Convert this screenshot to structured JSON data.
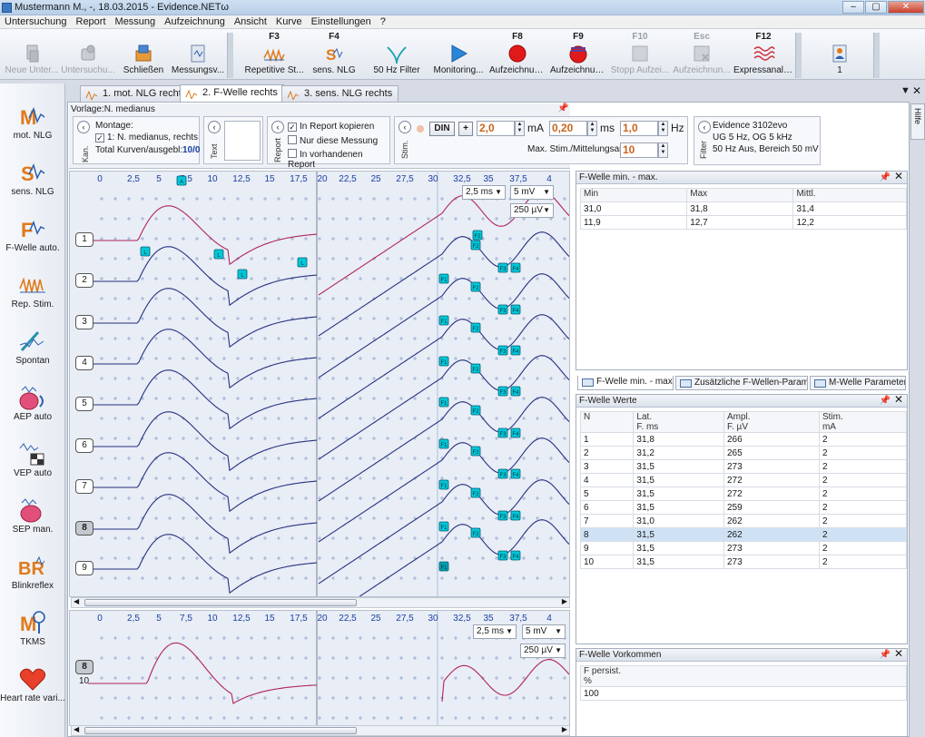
{
  "window": {
    "title": "Mustermann M., -, 18.03.2015 - Evidence.NETω",
    "controls": {
      "min": "–",
      "max": "▢",
      "close": "✕"
    }
  },
  "menu": [
    "Untersuchung",
    "Report",
    "Messung",
    "Aufzeichnung",
    "Ansicht",
    "Kurve",
    "Einstellungen",
    "?"
  ],
  "toolbar": {
    "new_exam": "Neue Unter...",
    "exam": "Untersuchu...",
    "close": "Schließen",
    "measure_settings": "Messungsv...",
    "repetitive": {
      "key": "F3",
      "label": "Repetitive St..."
    },
    "sens_nlg": {
      "key": "F4",
      "label": "sens. NLG"
    },
    "filter50": {
      "label": "50 Hz Filter"
    },
    "monitoring": {
      "label": "Monitoring..."
    },
    "record1": {
      "key": "F8",
      "label": "Aufzeichnun..."
    },
    "record2": {
      "key": "F9",
      "label": "Aufzeichnun..."
    },
    "stop": {
      "key": "F10",
      "label": "Stopp Aufzei..."
    },
    "record_esc": {
      "key": "Esc",
      "label": "Aufzeichnun..."
    },
    "express": {
      "key": "F12",
      "label": "Expressanaly..."
    },
    "user_count": "1"
  },
  "leftnav": [
    "mot. NLG",
    "sens. NLG",
    "F-Welle auto.",
    "Rep. Stim.",
    "Spontan",
    "AEP auto",
    "VEP auto",
    "SEP man.",
    "Blinkreflex",
    "TKMS",
    "Heart rate vari..."
  ],
  "leftnav_icon_letters": {
    "mot": "M",
    "sens": "S",
    "fwave": "F",
    "blink": "BR",
    "tkms": "M"
  },
  "doc_tabs": [
    "1. mot. NLG rechts",
    "2. F-Welle rechts",
    "3. sens. NLG rechts"
  ],
  "template": "Vorlage:N. medianus",
  "montage": {
    "vlabel": "Kan.",
    "title": "Montage:",
    "item": "1: N. medianus, rechts",
    "total_label": "Total Kurven/ausgebl:",
    "total_value": "10/0",
    "text_vlabel": "Text"
  },
  "report": {
    "vlabel": "Report",
    "copy": "In Report kopieren",
    "only_this": "Nur diese Messung",
    "existing": "In vorhandenen Report"
  },
  "stim": {
    "vlabel": "Stim.",
    "din": "DIN",
    "plus": "+",
    "current": "2,0",
    "current_unit": "mA",
    "duration": "0,20",
    "duration_unit": "ms",
    "freq": "1,0",
    "freq_unit": "Hz",
    "max_label": "Max. Stim./Mittelungsanzahl:",
    "max_value": "10"
  },
  "filter": {
    "vlabel": "Filter",
    "device": "Evidence 3102evo",
    "line1": "UG  5 Hz, OG  5 kHz",
    "line2": "50 Hz  Aus, Bereich  50 mV"
  },
  "scale": {
    "time": "2,5 ms",
    "volt1": "5 mV",
    "volt2": "250 µV"
  },
  "axis1": [
    "0",
    "2,5",
    "5",
    "7,5",
    "10",
    "12,5",
    "15",
    "17,5"
  ],
  "axis2": [
    "20",
    "22,5",
    "25",
    "27,5",
    "30",
    "32,5",
    "35",
    "37,5",
    "4"
  ],
  "trace_labels": [
    "1",
    "2",
    "3",
    "4",
    "5",
    "6",
    "7",
    "8",
    "9"
  ],
  "detail": {
    "label": "8",
    "sublabel": "10"
  },
  "markers": {
    "f1": "F1",
    "f2": "F2",
    "f3": "F3",
    "f4": "F4",
    "a": "A",
    "l": "L"
  },
  "minmax": {
    "title": "F-Welle min. - max.",
    "headers": [
      "Min",
      "Max",
      "Mittl."
    ],
    "rows": [
      [
        "31,0",
        "31,8",
        "31,4"
      ],
      [
        "11,9",
        "12,7",
        "12,2"
      ]
    ]
  },
  "btabs": [
    "F-Welle min. - max.",
    "Zusätzliche F-Wellen-Param...",
    "M-Welle Parameter"
  ],
  "values": {
    "title": "F-Welle Werte",
    "headers": [
      "N",
      "Lat.\nF. ms",
      "Ampl.\nF. µV",
      "Stim.\nmA"
    ],
    "rows": [
      [
        "1",
        "31,8",
        "266",
        "2"
      ],
      [
        "2",
        "31,2",
        "265",
        "2"
      ],
      [
        "3",
        "31,5",
        "273",
        "2"
      ],
      [
        "4",
        "31,5",
        "272",
        "2"
      ],
      [
        "5",
        "31,5",
        "272",
        "2"
      ],
      [
        "6",
        "31,5",
        "259",
        "2"
      ],
      [
        "7",
        "31,0",
        "262",
        "2"
      ],
      [
        "8",
        "31,5",
        "262",
        "2"
      ],
      [
        "9",
        "31,5",
        "273",
        "2"
      ],
      [
        "10",
        "31,5",
        "273",
        "2"
      ]
    ],
    "selected": 7
  },
  "persist": {
    "title": "F-Welle Vorkommen",
    "header": "F persist.\n%",
    "value": "100"
  },
  "help": "Hilfe",
  "colors": {
    "trace1": "#b0245a",
    "trace": "#26307f",
    "marker": "#00c8d8"
  }
}
